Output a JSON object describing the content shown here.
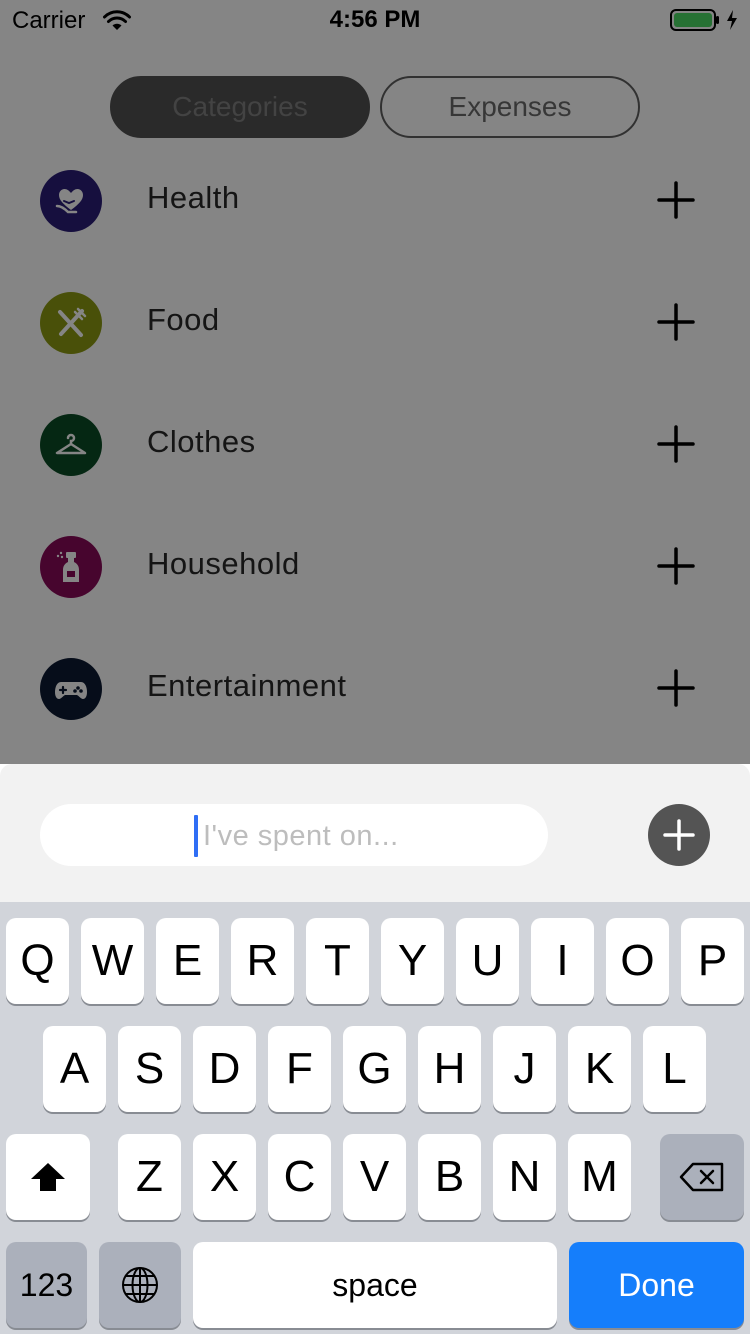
{
  "status_bar": {
    "carrier": "Carrier",
    "time": "4:56 PM"
  },
  "segmented": {
    "categories_label": "Categories",
    "expenses_label": "Expenses",
    "selected": "Categories"
  },
  "categories": [
    {
      "label": "Health",
      "color": "#2b1d78",
      "icon": "heart-hand-icon"
    },
    {
      "label": "Food",
      "color": "#8c9a13",
      "icon": "fork-knife-icon"
    },
    {
      "label": "Clothes",
      "color": "#0a4c25",
      "icon": "hanger-icon"
    },
    {
      "label": "Household",
      "color": "#880a59",
      "icon": "spray-bottle-icon"
    },
    {
      "label": "Entertainment",
      "color": "#0d1a33",
      "icon": "gamepad-icon"
    }
  ],
  "input_bar": {
    "placeholder": "I've spent on...",
    "add_button_color": "#545454"
  },
  "keyboard": {
    "row1": [
      "Q",
      "W",
      "E",
      "R",
      "T",
      "Y",
      "U",
      "I",
      "O",
      "P"
    ],
    "row2": [
      "A",
      "S",
      "D",
      "F",
      "G",
      "H",
      "J",
      "K",
      "L"
    ],
    "row3": [
      "Z",
      "X",
      "C",
      "V",
      "B",
      "N",
      "M"
    ],
    "numbers_key": "123",
    "space_key": "space",
    "done_key": "Done",
    "done_color": "#157efb"
  }
}
